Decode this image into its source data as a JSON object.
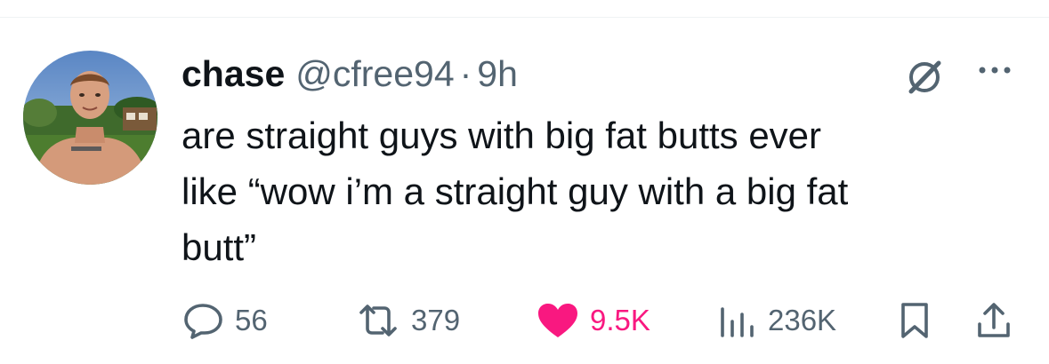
{
  "tweet": {
    "author": {
      "display_name": "chase",
      "handle": "@cfree94",
      "separator": "·",
      "time": "9h"
    },
    "text": "are straight guys with big fat butts ever\nlike “wow i’m a straight guy with a big fat\nbutt”",
    "actions": {
      "replies": "56",
      "reposts": "379",
      "likes": "9.5K",
      "views": "236K"
    },
    "liked": true
  },
  "colors": {
    "text_primary": "#0f1419",
    "text_secondary": "#536471",
    "like_active": "#f91880",
    "divider": "#eff3f4"
  },
  "icons": {
    "grok": "grok-icon",
    "more": "more-icon",
    "reply": "reply-icon",
    "repost": "repost-icon",
    "like": "heart-icon",
    "views": "views-icon",
    "bookmark": "bookmark-icon",
    "share": "share-icon"
  }
}
